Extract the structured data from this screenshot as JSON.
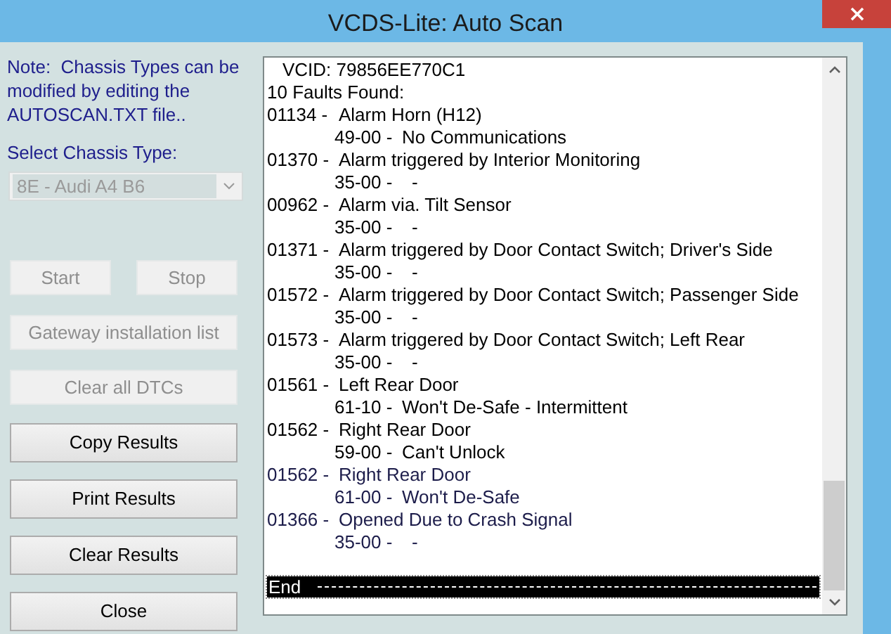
{
  "window": {
    "title": "VCDS-Lite: Auto Scan"
  },
  "note": "Note:  Chassis Types can be modified by editing the AUTOSCAN.TXT file..",
  "chassis": {
    "label": "Select Chassis Type:",
    "value": "8E - Audi A4 B6",
    "disabled": true
  },
  "buttons": [
    {
      "label": "Start",
      "disabled": true,
      "kind": "half"
    },
    {
      "label": "Stop",
      "disabled": true,
      "kind": "half"
    },
    {
      "label": "Gateway installation list",
      "disabled": true,
      "kind": "full"
    },
    {
      "label": "Clear all DTCs",
      "disabled": true,
      "kind": "full"
    },
    {
      "label": "Copy Results",
      "disabled": false,
      "kind": "full"
    },
    {
      "label": "Print Results",
      "disabled": false,
      "kind": "full"
    },
    {
      "label": "Clear Results",
      "disabled": false,
      "kind": "full"
    },
    {
      "label": "Close",
      "disabled": false,
      "kind": "full"
    }
  ],
  "results": {
    "vcid": "VCID: 79856EE770C1",
    "count": "10 Faults Found:",
    "faults": [
      {
        "code": "01134 -",
        "description": "Alarm Horn (H12)",
        "status_code": "49-00 -",
        "status": "No Communications",
        "color": "#000000"
      },
      {
        "code": "01370 -",
        "description": "Alarm triggered by Interior Monitoring",
        "status_code": "35-00 -",
        "status": "-",
        "color": "#000000"
      },
      {
        "code": "00962 -",
        "description": "Alarm via. Tilt Sensor",
        "status_code": "35-00 -",
        "status": "-",
        "color": "#000000"
      },
      {
        "code": "01371 -",
        "description": "Alarm triggered by Door Contact Switch; Driver's Side",
        "status_code": "35-00 -",
        "status": "-",
        "color": "#000000"
      },
      {
        "code": "01572 -",
        "description": "Alarm triggered by Door Contact Switch; Passenger Side",
        "status_code": "35-00 -",
        "status": "-",
        "color": "#000000"
      },
      {
        "code": "01573 -",
        "description": "Alarm triggered by Door Contact Switch; Left Rear",
        "status_code": "35-00 -",
        "status": "-",
        "color": "#000000"
      },
      {
        "code": "01561 -",
        "description": "Left Rear Door",
        "status_code": "61-10 -",
        "status": "Won't De-Safe - Intermittent",
        "color": "#000000"
      },
      {
        "code": "01562 -",
        "description": "Right Rear Door",
        "status_code": "59-00 -",
        "status": "Can't Unlock",
        "color": "#000000"
      },
      {
        "code": "01562 -",
        "description": "Right Rear Door",
        "status_code": "61-00 -",
        "status": "Won't De-Safe",
        "color": "#1c1c4a"
      },
      {
        "code": "01366 -",
        "description": "Opened Due to Crash Signal",
        "status_code": "35-00 -",
        "status": "-",
        "color": "#1c1c4a"
      }
    ],
    "end": {
      "text": "End",
      "selected": true
    }
  }
}
